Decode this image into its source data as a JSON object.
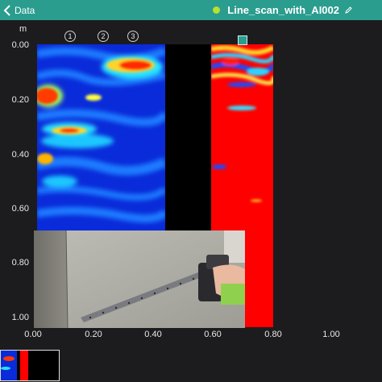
{
  "nav": {
    "back_label": "Data",
    "title": "Line_scan_with_AI002"
  },
  "colors": {
    "bar": "#2a9d8f",
    "status_dot": "#b7e02f",
    "background": "#1c1c1e"
  },
  "axes": {
    "y_unit": "m",
    "y_ticks": [
      "0.00",
      "0.20",
      "0.40",
      "0.60",
      "0.80",
      "1.00"
    ],
    "x_ticks": [
      "0.00",
      "0.20",
      "0.40",
      "0.60",
      "0.80",
      "1.00"
    ]
  },
  "markers": [
    "1",
    "2",
    "3"
  ],
  "icons": {
    "back": "chevron-left-icon",
    "edit": "pencil-icon",
    "status": "status-dot"
  }
}
